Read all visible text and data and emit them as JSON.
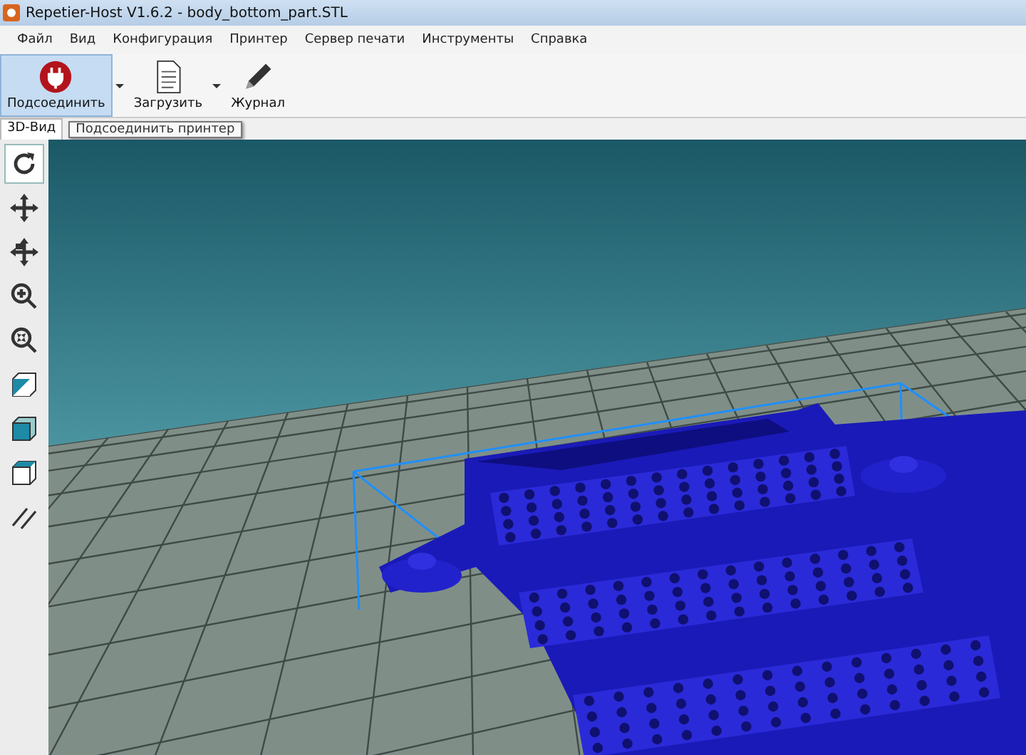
{
  "window": {
    "title": "Repetier-Host V1.6.2 - body_bottom_part.STL"
  },
  "menu": [
    "Файл",
    "Вид",
    "Конфигурация",
    "Принтер",
    "Сервер печати",
    "Инструменты",
    "Справка"
  ],
  "toolbar": [
    {
      "label": "Подсоединить",
      "kind": "connect",
      "highlighted": true,
      "has_menu": true
    },
    {
      "label": "Загрузить",
      "kind": "load",
      "highlighted": false,
      "has_menu": true
    },
    {
      "label": "Журнал",
      "kind": "log",
      "highlighted": false,
      "has_menu": false
    }
  ],
  "tabs": [
    {
      "label": "3D-Вид",
      "selected": true
    }
  ],
  "tooltip": "Подсоединить принтер",
  "view_tools": [
    {
      "kind": "rotate",
      "selected": true
    },
    {
      "kind": "move",
      "selected": false
    },
    {
      "kind": "move-object",
      "selected": false
    },
    {
      "kind": "zoom",
      "selected": false
    },
    {
      "kind": "zoom-fit",
      "selected": false
    },
    {
      "kind": "view-iso",
      "selected": false
    },
    {
      "kind": "view-front",
      "selected": false
    },
    {
      "kind": "view-top",
      "selected": false
    },
    {
      "kind": "parallel",
      "selected": false
    }
  ]
}
